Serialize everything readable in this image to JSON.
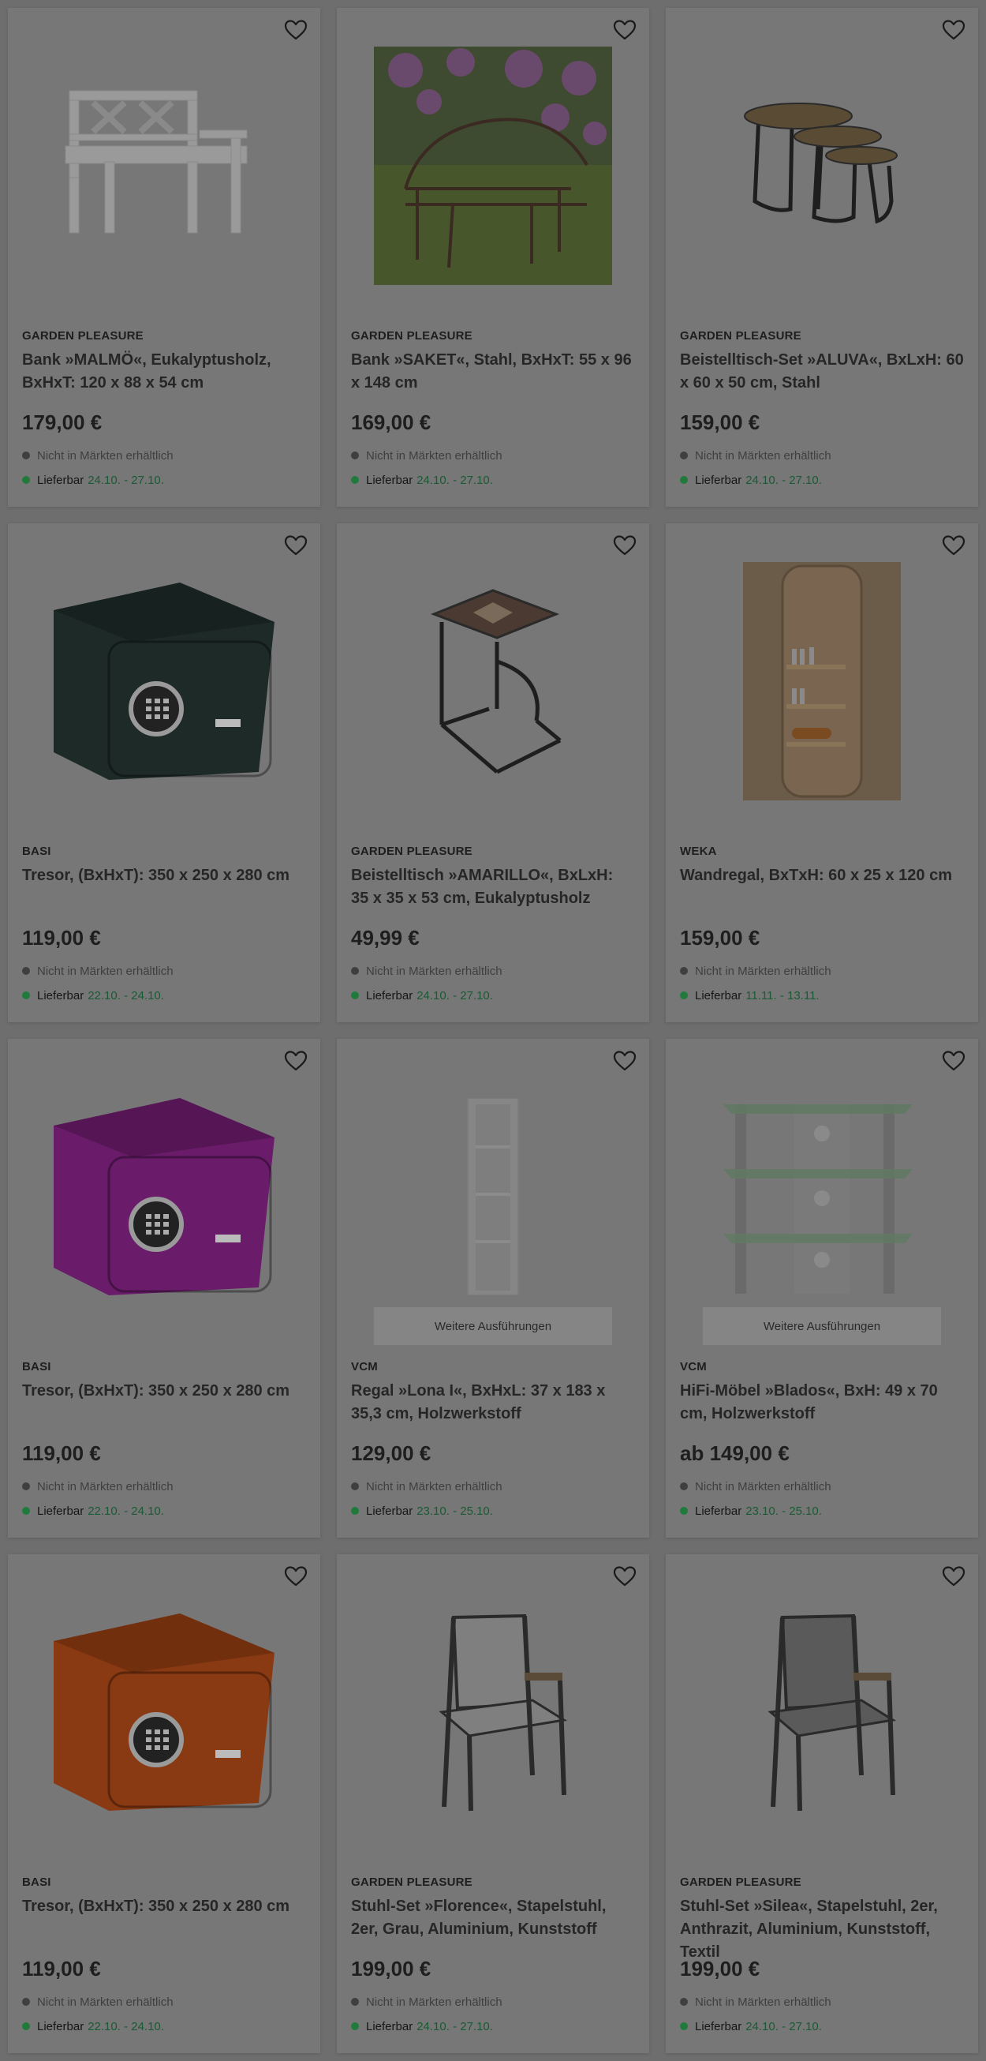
{
  "labels": {
    "store": "Nicht in Märkten erhältlich",
    "delivery": "Lieferbar",
    "variants": "Weitere Ausführungen"
  },
  "products": [
    {
      "brand": "GARDEN PLEASURE",
      "title": "Bank »MALMÖ«, Eukalyptusholz, BxHxT: 120 x 88 x 54 cm",
      "price": "179,00 €",
      "delivery": "24.10. - 27.10.",
      "image": "bench-white-wood"
    },
    {
      "brand": "GARDEN PLEASURE",
      "title": "Bank »SAKET«, Stahl, BxHxT: 55 x 96 x 148 cm",
      "price": "169,00 €",
      "delivery": "24.10. - 27.10.",
      "image": "bench-metal-garden-photo"
    },
    {
      "brand": "GARDEN PLEASURE",
      "title": "Beistelltisch-Set »ALUVA«, BxLxH: 60 x 60 x 50 cm, Stahl",
      "price": "159,00 €",
      "delivery": "24.10. - 27.10.",
      "image": "nesting-tables"
    },
    {
      "brand": "BASI",
      "title": "Tresor, (BxHxT): 350 x 250 x 280 cm",
      "price": "119,00 €",
      "delivery": "22.10. - 24.10.",
      "image": "safe-black",
      "color": "#1d2a28"
    },
    {
      "brand": "GARDEN PLEASURE",
      "title": "Beistelltisch »AMARILLO«, BxLxH: 35 x 35 x 53 cm, Eukalyptusholz",
      "price": "49,99 €",
      "delivery": "24.10. - 27.10.",
      "image": "side-table-mosaic"
    },
    {
      "brand": "WEKA",
      "title": "Wandregal, BxTxH: 60 x 25 x 120 cm",
      "price": "159,00 €",
      "delivery": "11.11. - 13.11.",
      "image": "wall-shelf-wood"
    },
    {
      "brand": "BASI",
      "title": "Tresor, (BxHxT): 350 x 250 x 280 cm",
      "price": "119,00 €",
      "delivery": "22.10. - 24.10.",
      "image": "safe-purple",
      "color": "#6a1c6a"
    },
    {
      "brand": "VCM",
      "title": "Regal »Lona I«, BxHxL: 37 x 183 x 35,3 cm, Holzwerkstoff",
      "price": "129,00 €",
      "delivery": "23.10. - 25.10.",
      "image": "tall-shelf-white",
      "variants": true
    },
    {
      "brand": "VCM",
      "title": "HiFi-Möbel »Blados«, BxH: 49 x 70 cm, Holzwerkstoff",
      "price": "ab 149,00 €",
      "delivery": "23.10. - 25.10.",
      "image": "glass-hifi-rack",
      "variants": true
    },
    {
      "brand": "BASI",
      "title": "Tresor, (BxHxT): 350 x 250 x 280 cm",
      "price": "119,00 €",
      "delivery": "22.10. - 24.10.",
      "image": "safe-orange",
      "color": "#8a3a12"
    },
    {
      "brand": "GARDEN PLEASURE",
      "title": "Stuhl-Set »Florence«, Stapelstuhl, 2er, Grau, Aluminium, Kunststoff",
      "price": "199,00 €",
      "delivery": "24.10. - 27.10.",
      "image": "chair-grey"
    },
    {
      "brand": "GARDEN PLEASURE",
      "title": "Stuhl-Set »Silea«, Stapelstuhl, 2er, Anthrazit, Aluminium, Kunststoff, Textil",
      "price": "199,00 €",
      "delivery": "24.10. - 27.10.",
      "image": "chair-anthracite"
    }
  ]
}
